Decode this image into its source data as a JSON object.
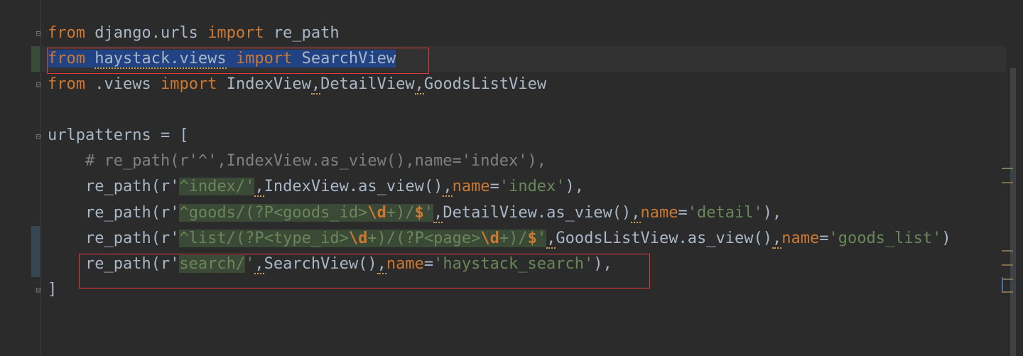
{
  "lines": [
    {
      "id": "l1"
    },
    {
      "id": "l2"
    }
  ],
  "tokens": {
    "from": "from",
    "import": "import",
    "django_urls": "django.urls",
    "re_path": "re_path",
    "haystack_views": "haystack.views",
    "SearchView": "SearchView",
    "dot_views": ".views",
    "IndexView": "IndexView",
    "comma": ",",
    "DetailView": "DetailView",
    "GoodsListView": "GoodsListView",
    "urlpatterns": "urlpatterns = [",
    "comment": "# re_path(r'^',IndexView.as_view(),name='index'),",
    "close_bracket": "]"
  },
  "code": {
    "line5_name": "re_path(r'",
    "caret": "^",
    "index_re": "index/",
    "quote": "'",
    "index_rest": "IndexView.as_view()",
    "name_kw": "name",
    "eq": "=",
    "index_name": "'index'",
    "tail": "),",
    "goods_re": "goods/",
    "paren_open": "(",
    "grp_goods": "?P<goods_id>",
    "esc_d": "\\d",
    "plus_close": "+)/",
    "dollar": "$",
    "detail_rest": "DetailView.as_view()",
    "detail_name": "'detail'",
    "list_re": "list/",
    "grp_type": "?P<type_id>",
    "grp_page": "?P<page>",
    "list_rest": "GoodsListView.as_view()",
    "list_name": "'goods_list'",
    "list_tail": ")",
    "search_re": "search/",
    "search_rest": "SearchView()",
    "search_name": "'haystack_search'"
  },
  "colors": {
    "keyword": "#cc7832",
    "string": "#6a8759",
    "text": "#a9b7c6",
    "comment": "#808080",
    "selection": "#214283",
    "annotation_box": "#e03a3a"
  }
}
